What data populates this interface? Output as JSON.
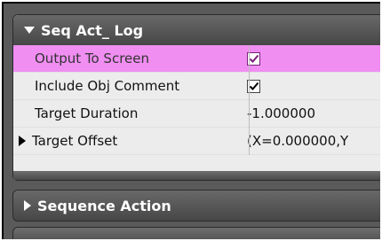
{
  "panel": {
    "group_title": "Seq Act_ Log",
    "properties": [
      {
        "label": "Output To Screen",
        "type": "checkbox",
        "checked": true,
        "highlighted": true
      },
      {
        "label": "Include Obj Comment",
        "type": "checkbox",
        "checked": true,
        "highlighted": false
      },
      {
        "label": "Target Duration",
        "type": "text",
        "value": "-1.000000"
      },
      {
        "label": "Target Offset",
        "type": "text",
        "value": "(X=0.000000,Y",
        "expandable": true
      }
    ],
    "collapsed_group_title": "Sequence Action"
  },
  "colors": {
    "highlight": "#f08ef2",
    "header_bg": "#5a5a5a",
    "panel_bg": "#ececec"
  },
  "icons": {
    "expand_open": "triangle-down",
    "expand_closed": "triangle-right",
    "checkbox_checked": "check"
  }
}
